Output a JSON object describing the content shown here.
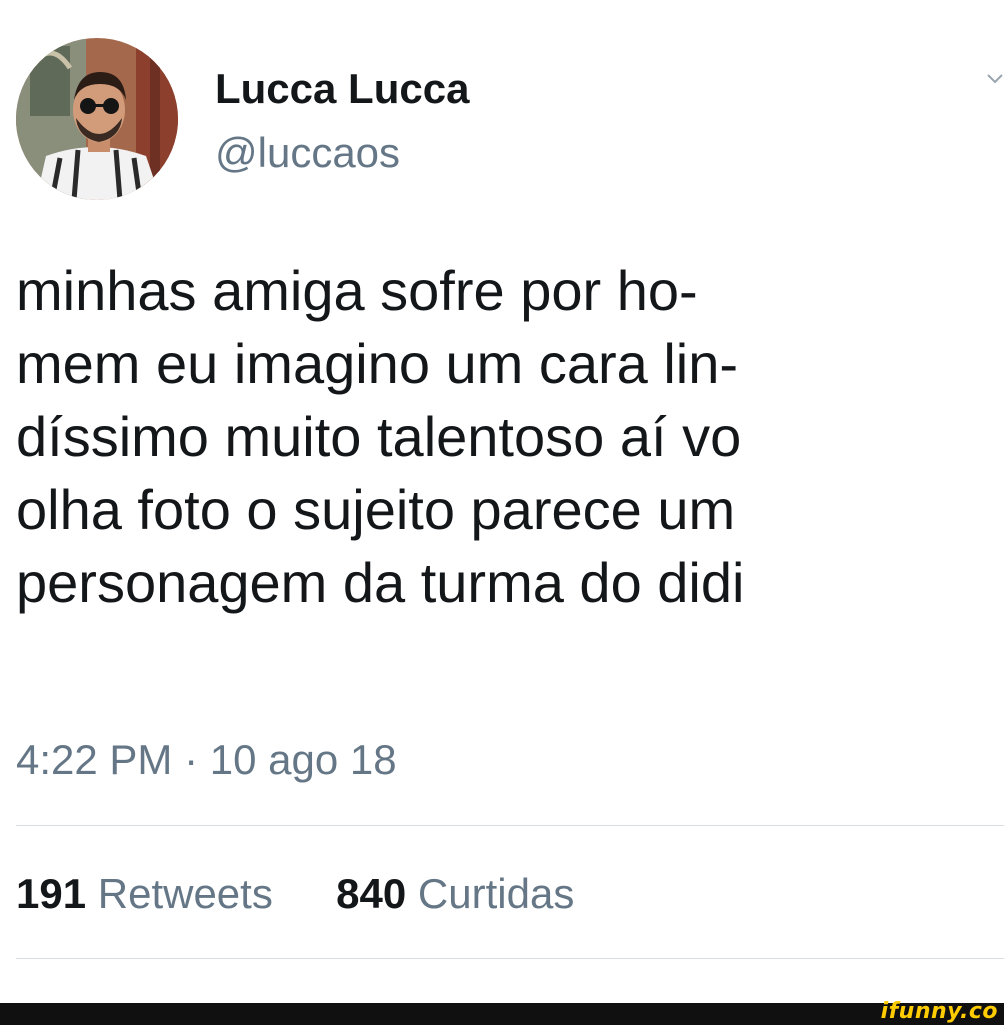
{
  "user": {
    "display_name": "Lucca Lucca",
    "handle": "@luccaos"
  },
  "tweet": {
    "lines": [
      "minhas amiga sofre por ho-",
      "mem eu imagino um cara lin-",
      "díssimo muito talentoso aí vo",
      "olha foto o sujeito parece um",
      "personagem da turma do didi"
    ],
    "timestamp": "4:22 PM · 10 ago 18"
  },
  "stats": {
    "retweets_count": "191",
    "retweets_label": "Retweets",
    "likes_count": "840",
    "likes_label": "Curtidas"
  },
  "watermark": "ifunny.co",
  "icons": {
    "avatar": "profile-photo-icon",
    "menu": "chevron-down-icon"
  },
  "colors": {
    "primary_text": "#14171a",
    "secondary_text": "#657786",
    "divider": "#d7dde2",
    "watermark": "#ffcc00"
  }
}
